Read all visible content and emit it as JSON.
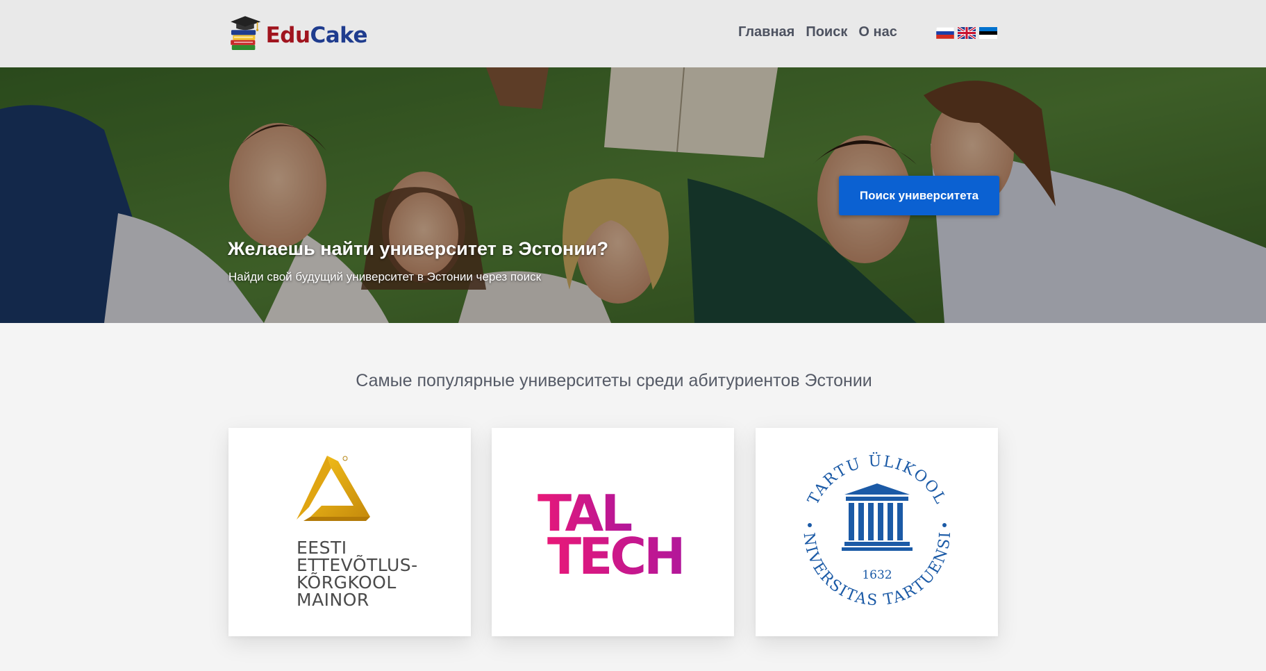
{
  "header": {
    "logo": {
      "part1": "Edu",
      "part2": "Cake"
    },
    "nav": [
      {
        "label": "Главная"
      },
      {
        "label": "Поиск"
      },
      {
        "label": "О нас"
      }
    ],
    "languages": [
      "russian-flag",
      "uk-flag",
      "estonian-flag"
    ]
  },
  "hero": {
    "title": "Желаешь найти университет в Эстонии?",
    "subtitle": "Найди свой будущий университет в Эстонии через поиск",
    "button_label": "Поиск университета",
    "button_color": "#0b61d2"
  },
  "popular": {
    "title": "Самые популярные университеты среди абитуриентов Эстонии",
    "universities": [
      {
        "name_lines": [
          "EESTI",
          "ETTEVÕTLUS-",
          "KÕRGKOOL",
          "MAINOR"
        ]
      },
      {
        "logo_lines": [
          "TAL",
          "TECH"
        ],
        "color": "#e4147a"
      },
      {
        "seal_top": "TARTU ÜLIKOOL",
        "seal_bottom": "UNIVERSITAS TARTUENSIS",
        "year": "1632",
        "color": "#1b5aa6"
      }
    ]
  }
}
